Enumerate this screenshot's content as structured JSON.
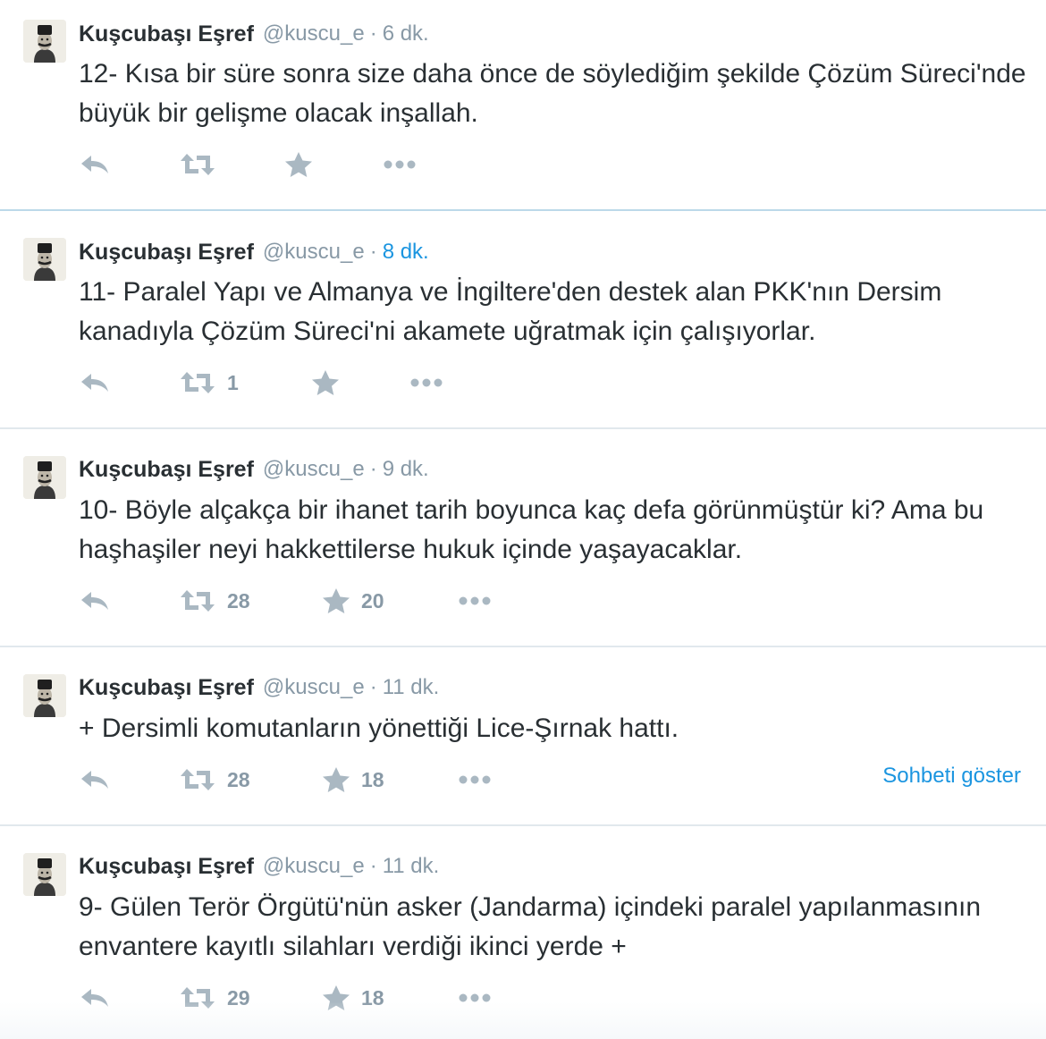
{
  "tweets": [
    {
      "name": "Kuşcubaşı Eşref",
      "handle": "@kuscu_e",
      "separator": "·",
      "time": "6 dk.",
      "text": "12- Kısa bir süre sonra size daha önce de söylediğim şekilde Çözüm Süreci'nde   büyük bir gelişme olacak inşallah.",
      "retweets": "",
      "likes": ""
    },
    {
      "name": "Kuşcubaşı Eşref",
      "handle": "@kuscu_e",
      "separator": "·",
      "time": "8 dk.",
      "text": "11- Paralel Yapı ve Almanya ve İngiltere'den destek alan PKK'nın Dersim kanadıyla Çözüm Süreci'ni akamete uğratmak için çalışıyorlar.",
      "retweets": "1",
      "likes": ""
    },
    {
      "name": "Kuşcubaşı Eşref",
      "handle": "@kuscu_e",
      "separator": "·",
      "time": "9 dk.",
      "text": "10- Böyle alçakça bir ihanet tarih boyunca kaç defa görünmüştür ki? Ama bu haşhaşiler neyi hakkettilerse hukuk içinde yaşayacaklar.",
      "retweets": "28",
      "likes": "20"
    },
    {
      "name": "Kuşcubaşı Eşref",
      "handle": "@kuscu_e",
      "separator": "·",
      "time": "11 dk.",
      "text": "+ Dersimli komutanların yönettiği Lice-Şırnak hattı.",
      "retweets": "28",
      "likes": "18",
      "conversation_link": "Sohbeti göster"
    },
    {
      "name": "Kuşcubaşı Eşref",
      "handle": "@kuscu_e",
      "separator": "·",
      "time": "11 dk.",
      "text": "9- Gülen Terör Örgütü'nün asker (Jandarma) içindeki paralel yapılanmasının envantere kayıtlı silahları verdiği ikinci yerde +",
      "retweets": "29",
      "likes": "18"
    }
  ],
  "icons": {
    "reply": "reply-icon",
    "retweet": "retweet-icon",
    "like": "star-icon",
    "more": "more-dots-icon",
    "avatar": "avatar-portrait"
  },
  "colors": {
    "text": "#292f33",
    "muted": "#8899a6",
    "link": "#1b95e0",
    "icon": "#aab8c2",
    "divider": "#e1e8ed",
    "active_divider": "#bcd9e9"
  }
}
